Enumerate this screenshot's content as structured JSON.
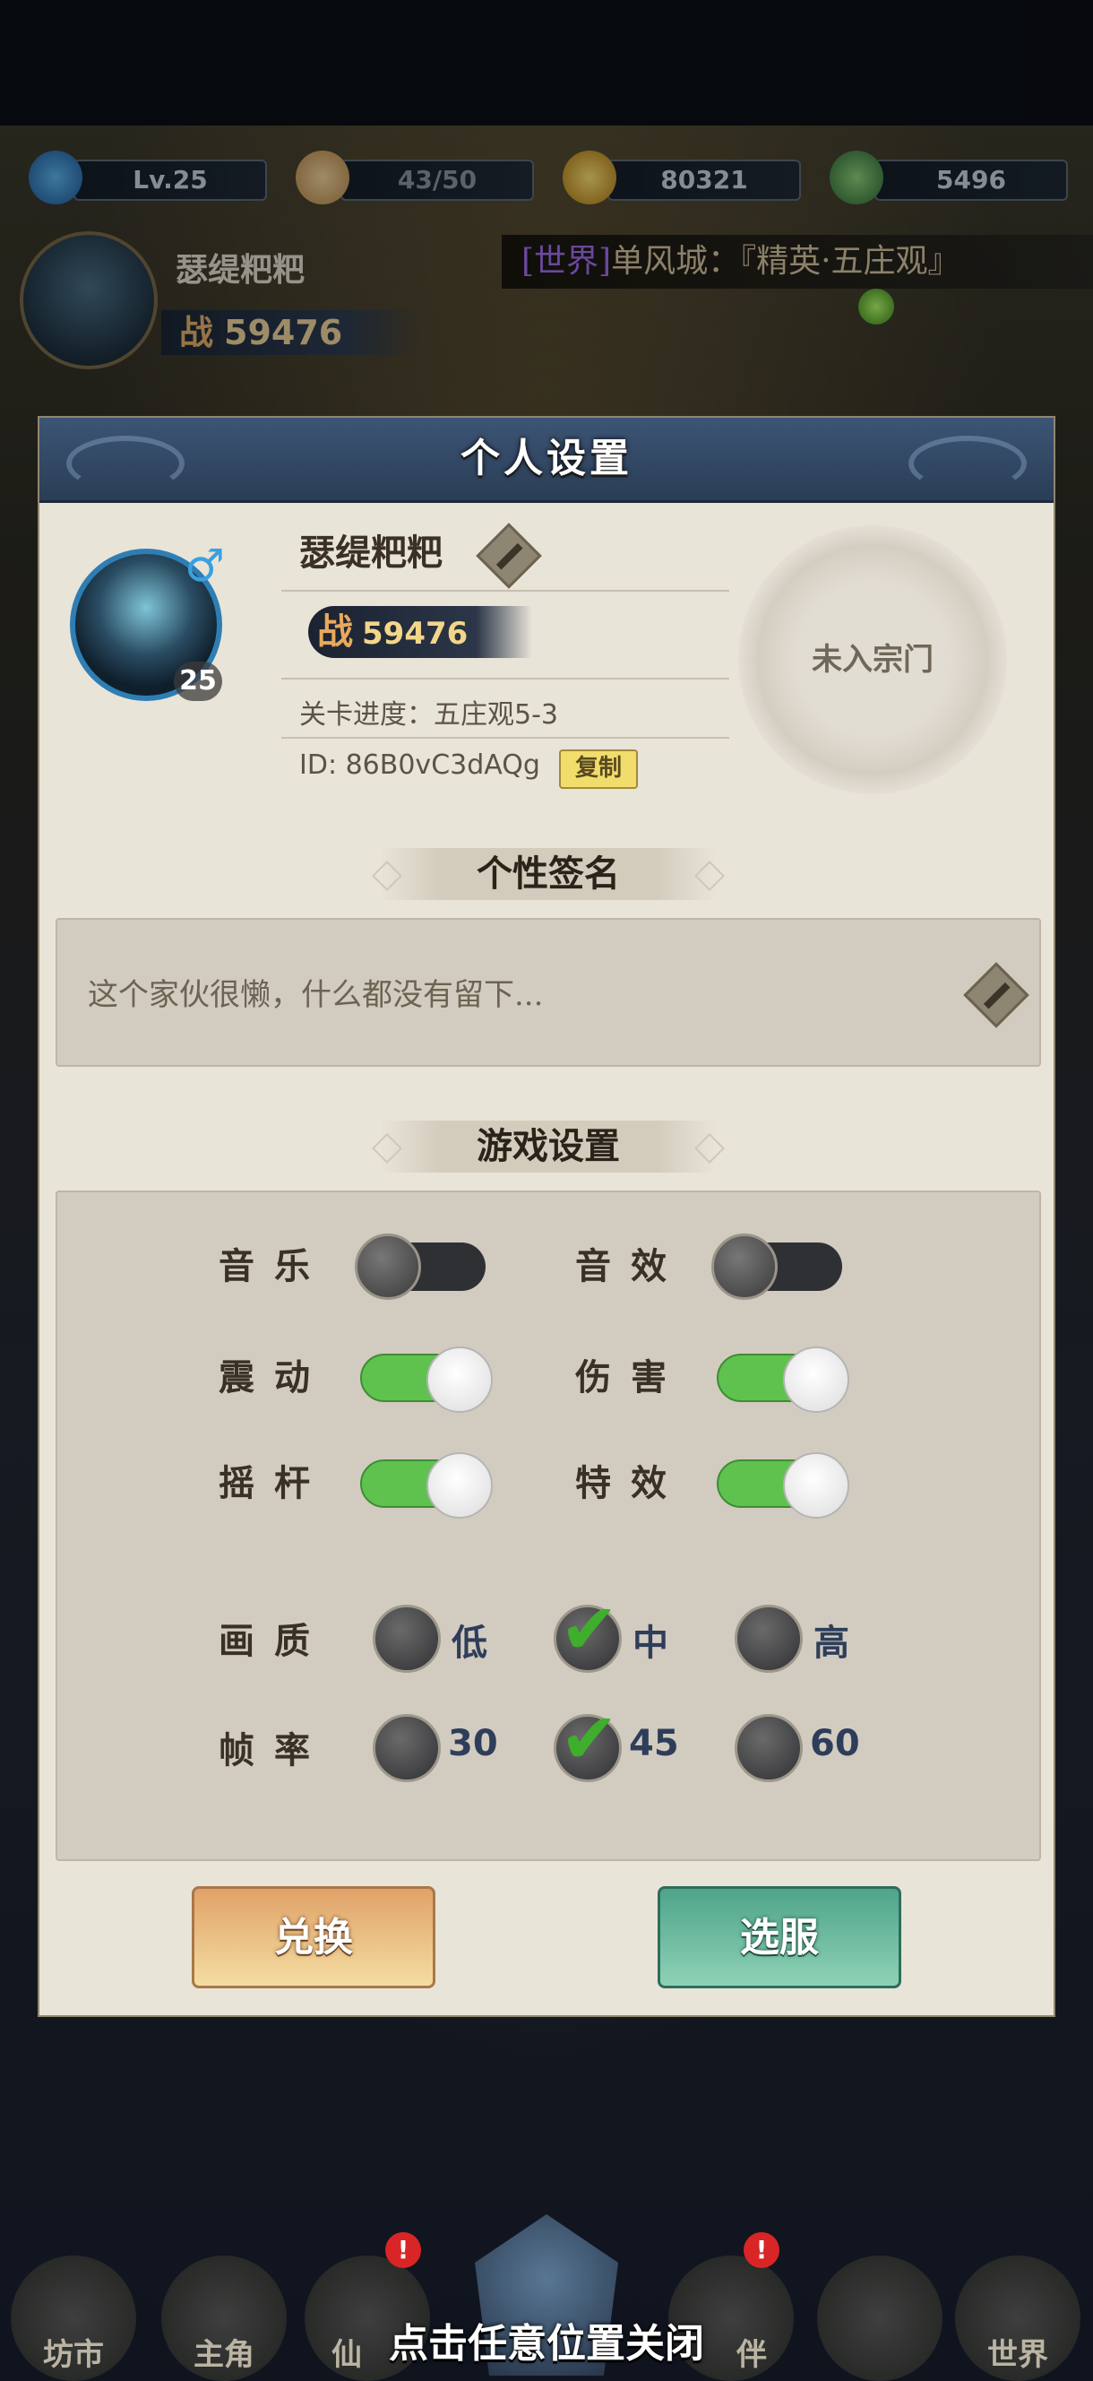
{
  "hud": {
    "level": "Lv.25",
    "food": "43/50",
    "coins": "80321",
    "jade": "5496",
    "player_name": "瑟缇粑粑",
    "power_prefix": "战",
    "power_value": "59476",
    "broadcast_tag": "[世界]",
    "broadcast_text": "单风城：『精英·五庄观』"
  },
  "modal": {
    "title": "个人设置",
    "profile": {
      "name": "瑟缇粑粑",
      "gender_symbol": "♂",
      "level": "25",
      "power_prefix": "战",
      "power_value": "59476",
      "stage_progress": "关卡进度：五庄观5-3",
      "id_text": "ID: 86B0vC3dAQg",
      "copy_label": "复制",
      "sect_status": "未入宗门"
    },
    "signature": {
      "header": "个性签名",
      "text": "这个家伙很懒，什么都没有留下..."
    },
    "game_settings": {
      "header": "游戏设置",
      "toggles": [
        {
          "label": "音乐",
          "on": false
        },
        {
          "label": "音效",
          "on": false
        },
        {
          "label": "震动",
          "on": true
        },
        {
          "label": "伤害",
          "on": true
        },
        {
          "label": "摇杆",
          "on": true
        },
        {
          "label": "特效",
          "on": true
        }
      ],
      "quality": {
        "label": "画质",
        "options": [
          "低",
          "中",
          "高"
        ],
        "selected": "中"
      },
      "framerate": {
        "label": "帧率",
        "options": [
          "30",
          "45",
          "60"
        ],
        "selected": "45"
      }
    },
    "buttons": {
      "redeem": "兑换",
      "select_server": "选服"
    }
  },
  "bottom_nav": {
    "items": [
      "坊市",
      "主角",
      "仙",
      "伴",
      "世界"
    ],
    "badge": "!",
    "close_hint": "点击任意位置关闭"
  },
  "colors": {
    "toggle_on": "#5fc24f",
    "check": "#3fae2c",
    "panel": "#e9e4d8"
  }
}
